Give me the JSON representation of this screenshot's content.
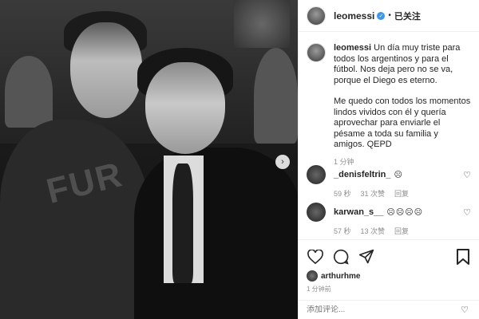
{
  "header": {
    "username": "leomessi",
    "follow_status": "已关注"
  },
  "caption": {
    "username": "leomessi",
    "paragraph1": "Un día muy triste para todos los argentinos y para el fútbol. Nos deja pero no se va, porque el Diego es eterno.",
    "paragraph2": "Me quedo con todos los momentos lindos vividos con él y quería aprovechar para enviarle el pésame a toda su familia y amigos. QEPD",
    "time": "1 分钟"
  },
  "photo": {
    "hood_text": "FUR"
  },
  "comments": [
    {
      "username": "_denisfeltrin_",
      "emoji": "☹",
      "time": "59 秒",
      "likes": "31 次赞",
      "reply": "回复"
    },
    {
      "username": "karwan_s__",
      "emoji": "☹☹☹☹",
      "time": "57 秒",
      "likes": "13 次赞",
      "reply": "回复"
    }
  ],
  "likes": {
    "liker": "arthurhme",
    "post_time": "1 分钟前"
  },
  "add_comment": {
    "placeholder": "添加评论..."
  }
}
